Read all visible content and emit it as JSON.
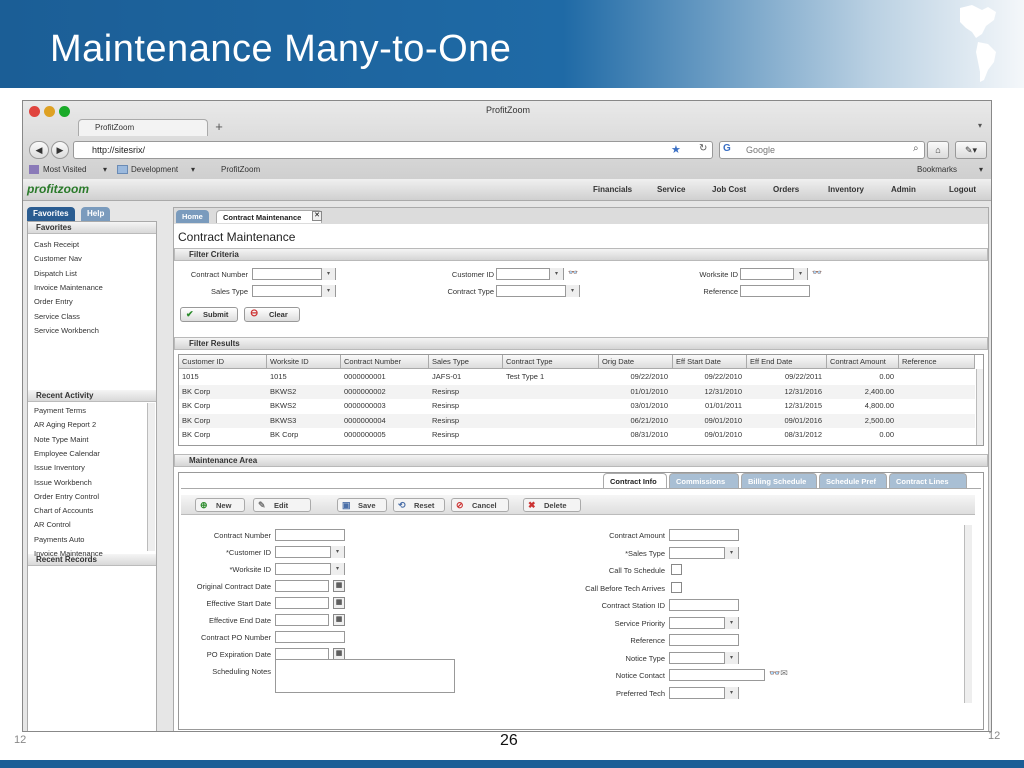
{
  "slide": {
    "title": "Maintenance Many-to-One",
    "page_number": "26",
    "left_num": "12",
    "right_num": "12"
  },
  "browser": {
    "window_title": "ProfitZoom",
    "tab_title": "ProfitZoom",
    "new_tab": "+",
    "url": "http://sitesrix/",
    "search_placeholder": "Google",
    "bookmarks": [
      "Most Visited",
      "Development",
      "ProfitZoom"
    ],
    "bookmarks_menu": "Bookmarks"
  },
  "app": {
    "logo": "profitzoom",
    "nav": [
      "Financials",
      "Service",
      "Job Cost",
      "Orders",
      "Inventory",
      "Admin",
      "Logout"
    ]
  },
  "left": {
    "tabs": [
      "Favorites",
      "Help"
    ],
    "favorites_header": "Favorites",
    "favorites": [
      "Cash Receipt",
      "Customer Nav",
      "Dispatch List",
      "Invoice Maintenance",
      "Order Entry",
      "Service Class",
      "Service Workbench"
    ],
    "recent_activity_header": "Recent Activity",
    "recent_activity": [
      "Payment Terms",
      "AR Aging Report 2",
      "Note Type Maint",
      "Employee Calendar",
      "Issue Inventory",
      "Issue Workbench",
      "Order Entry Control",
      "Chart of Accounts",
      "AR Control",
      "Payments Auto",
      "Invoice Maintenance"
    ],
    "recent_records_header": "Recent Records"
  },
  "main": {
    "tabs": [
      "Home",
      "Contract Maintenance"
    ],
    "page_title": "Contract Maintenance",
    "filter_criteria": {
      "header": "Filter Criteria",
      "contract_number": "Contract Number",
      "sales_type": "Sales Type",
      "customer_id": "Customer ID",
      "contract_type": "Contract Type",
      "worksite_id": "Worksite ID",
      "reference": "Reference",
      "submit": "Submit",
      "clear": "Clear"
    },
    "filter_results": {
      "header": "Filter Results",
      "columns": [
        "Customer ID",
        "Worksite ID",
        "Contract Number",
        "Sales Type",
        "Contract Type",
        "Orig Date",
        "Eff Start Date",
        "Eff End Date",
        "Contract Amount",
        "Reference"
      ],
      "rows": [
        [
          "1015",
          "1015",
          "0000000001",
          "JAFS-01",
          "Test Type 1",
          "09/22/2010",
          "09/22/2010",
          "09/22/2011",
          "0.00",
          ""
        ],
        [
          "BK Corp",
          "BKWS2",
          "0000000002",
          "Resinsp",
          "",
          "01/01/2010",
          "12/31/2010",
          "12/31/2016",
          "2,400.00",
          ""
        ],
        [
          "BK Corp",
          "BKWS2",
          "0000000003",
          "Resinsp",
          "",
          "03/01/2010",
          "01/01/2011",
          "12/31/2015",
          "4,800.00",
          ""
        ],
        [
          "BK Corp",
          "BKWS3",
          "0000000004",
          "Resinsp",
          "",
          "06/21/2010",
          "09/01/2010",
          "09/01/2016",
          "2,500.00",
          ""
        ],
        [
          "BK Corp",
          "BK Corp",
          "0000000005",
          "Resinsp",
          "",
          "08/31/2010",
          "09/01/2010",
          "08/31/2012",
          "0.00",
          ""
        ]
      ]
    },
    "maintenance": {
      "header": "Maintenance Area",
      "tabs": [
        "Contract Info",
        "Commissions",
        "Billing Schedule",
        "Schedule Pref",
        "Contract Lines"
      ],
      "toolbar": [
        "New",
        "Edit",
        "Save",
        "Reset",
        "Cancel",
        "Delete"
      ],
      "left_fields": [
        "Contract Number",
        "*Customer ID",
        "*Worksite ID",
        "Original Contract Date",
        "Effective Start Date",
        "Effective End Date",
        "Contract PO Number",
        "PO Expiration Date",
        "Scheduling Notes"
      ],
      "right_fields": [
        "Contract Amount",
        "*Sales Type",
        "Call To Schedule",
        "Call Before Tech Arrives",
        "Contract Station ID",
        "Service Priority",
        "Reference",
        "Notice Type",
        "Notice Contact",
        "Preferred Tech"
      ]
    }
  }
}
